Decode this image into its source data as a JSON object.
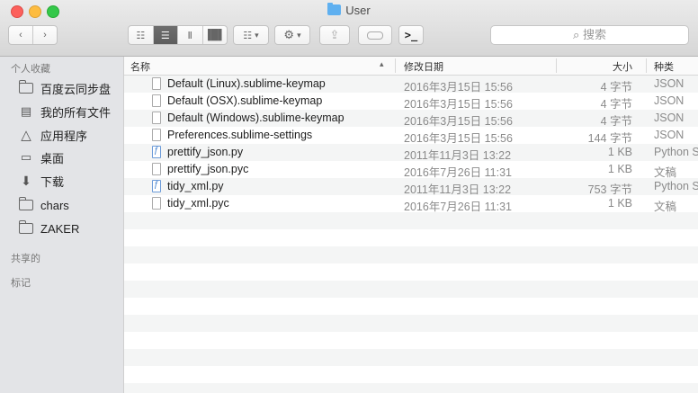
{
  "window": {
    "title": "User"
  },
  "toolbar": {
    "back_icon": "chevron-left-icon",
    "forward_icon": "chevron-right-icon",
    "search_placeholder": "搜索"
  },
  "sidebar": {
    "favorites_header": "个人收藏",
    "items": [
      {
        "label": "百度云同步盘",
        "icon": "folder-icon"
      },
      {
        "label": "我的所有文件",
        "icon": "all-files-icon"
      },
      {
        "label": "应用程序",
        "icon": "applications-icon"
      },
      {
        "label": "桌面",
        "icon": "desktop-icon"
      },
      {
        "label": "下载",
        "icon": "download-icon"
      },
      {
        "label": "chars",
        "icon": "folder-icon"
      },
      {
        "label": "ZAKER",
        "icon": "folder-icon"
      }
    ],
    "shared_header": "共享的",
    "tags_header": "标记"
  },
  "columns": {
    "name": "名称",
    "date": "修改日期",
    "size": "大小",
    "kind": "种类"
  },
  "files": [
    {
      "name": "Default (Linux).sublime-keymap",
      "date": "2016年3月15日 15:56",
      "size": "4 字节",
      "kind": "JSON"
    },
    {
      "name": "Default (OSX).sublime-keymap",
      "date": "2016年3月15日 15:56",
      "size": "4 字节",
      "kind": "JSON"
    },
    {
      "name": "Default (Windows).sublime-keymap",
      "date": "2016年3月15日 15:56",
      "size": "4 字节",
      "kind": "JSON"
    },
    {
      "name": "Preferences.sublime-settings",
      "date": "2016年3月15日 15:56",
      "size": "144 字节",
      "kind": "JSON"
    },
    {
      "name": "prettify_json.py",
      "date": "2011年11月3日 13:22",
      "size": "1 KB",
      "kind": "Python S"
    },
    {
      "name": "prettify_json.pyc",
      "date": "2016年7月26日 11:31",
      "size": "1 KB",
      "kind": "文稿"
    },
    {
      "name": "tidy_xml.py",
      "date": "2011年11月3日 13:22",
      "size": "753 字节",
      "kind": "Python S"
    },
    {
      "name": "tidy_xml.pyc",
      "date": "2016年7月26日 11:31",
      "size": "1 KB",
      "kind": "文稿"
    }
  ]
}
